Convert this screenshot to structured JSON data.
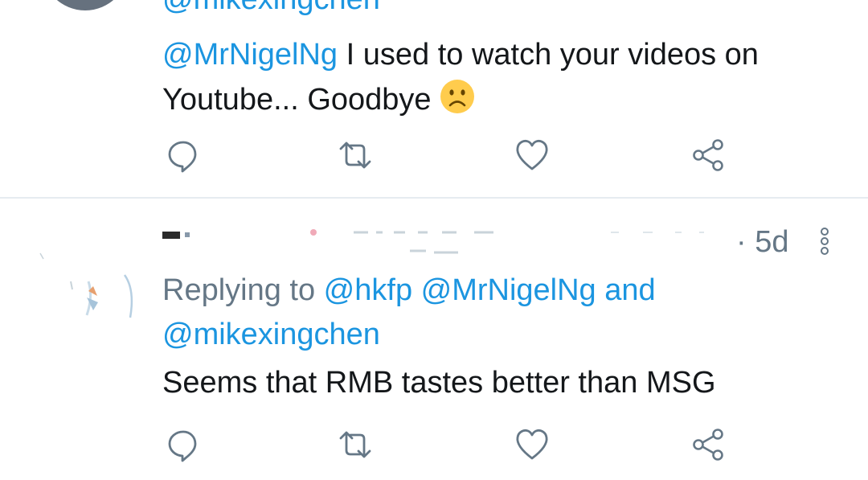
{
  "tweet_top": {
    "handle": "@mikexingchen",
    "mention": "@MrNigelNg",
    "text": " I used to watch your videos on Youtube... Goodbye ",
    "emoji": "frowning-face-emoji"
  },
  "tweet_reply": {
    "timestamp": "· 5d",
    "replying_prefix": "Replying to ",
    "replying_handles": [
      "@hkfp",
      "@MrNigelNg"
    ],
    "replying_and": " and ",
    "replying_last": "@mikexingchen",
    "text": "Seems that RMB tastes better than MSG"
  },
  "action_icons": [
    "reply-icon",
    "retweet-icon",
    "like-icon",
    "share-icon"
  ],
  "colors": {
    "link": "#1b95e0",
    "secondary_text": "#657786",
    "icon": "#657786",
    "divider": "#e6ecf0"
  }
}
